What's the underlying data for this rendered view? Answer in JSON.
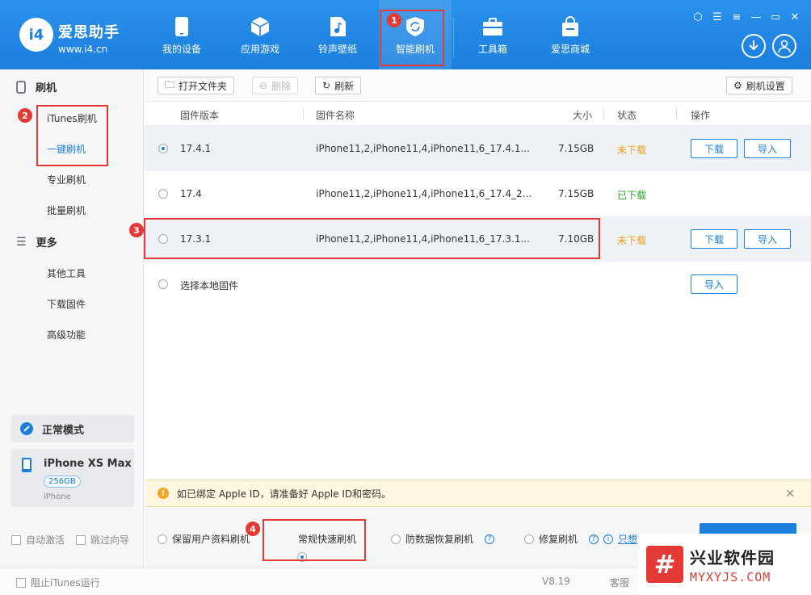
{
  "app": {
    "brand_name": "爱思助手",
    "brand_url": "www.i4.cn",
    "logo_text": "i4"
  },
  "nav": [
    {
      "label": "我的设备",
      "icon": "phone-icon"
    },
    {
      "label": "应用游戏",
      "icon": "cube-icon"
    },
    {
      "label": "铃声壁纸",
      "icon": "music-file-icon"
    },
    {
      "label": "智能刷机",
      "icon": "shield-refresh-icon"
    },
    {
      "label": "工具箱",
      "icon": "toolbox-icon"
    },
    {
      "label": "爱思商城",
      "icon": "shopping-bag-icon"
    }
  ],
  "sidebar": {
    "section1": "刷机",
    "items1": [
      "iTunes刷机",
      "一键刷机",
      "专业刷机",
      "批量刷机"
    ],
    "section2": "更多",
    "items2": [
      "其他工具",
      "下载固件",
      "高级功能"
    ],
    "mode": "正常模式",
    "device_name": "iPhone XS Max",
    "device_capacity": "256GB",
    "device_type": "iPhone",
    "auto_activate": "自动激活",
    "skip_guide": "跳过向导"
  },
  "toolbar": {
    "open_folder": "打开文件夹",
    "delete": "删除",
    "refresh": "刷新",
    "settings": "刷机设置"
  },
  "table": {
    "headers": {
      "version": "固件版本",
      "name": "固件名称",
      "size": "大小",
      "status": "状态",
      "action": "操作"
    },
    "rows": [
      {
        "version": "17.4.1",
        "name": "iPhone11,2,iPhone11,4,iPhone11,6_17.4.1...",
        "size": "7.15GB",
        "status": "未下载"
      },
      {
        "version": "17.4",
        "name": "iPhone11,2,iPhone11,4,iPhone11,6_17.4_2...",
        "size": "7.15GB",
        "status": "已下载"
      },
      {
        "version": "17.3.1",
        "name": "iPhone11,2,iPhone11,4,iPhone11,6_17.3.1...",
        "size": "7.10GB",
        "status": "未下载"
      }
    ],
    "local_label": "选择本地固件",
    "download_btn": "下载",
    "import_btn": "导入"
  },
  "alert": {
    "text": "如已绑定 Apple ID，请准备好 Apple ID和密码。"
  },
  "options": {
    "keep_data": "保留用户资料刷机",
    "quick": "常规快速刷机",
    "anti_recovery": "防数据恢复刷机",
    "repair": "修复刷机",
    "only_link": "只想"
  },
  "statusbar": {
    "block_itunes": "阻止iTunes运行",
    "version": "V8.19",
    "service": "客服"
  },
  "annotations": [
    "1",
    "2",
    "3",
    "4"
  ],
  "watermark": {
    "cn": "兴业软件园",
    "en": "MYXYJS.COM"
  },
  "colors": {
    "primary": "#1b7fdd",
    "annotation": "#e53935",
    "not_downloaded": "#f0a020",
    "downloaded": "#2aa52a"
  }
}
